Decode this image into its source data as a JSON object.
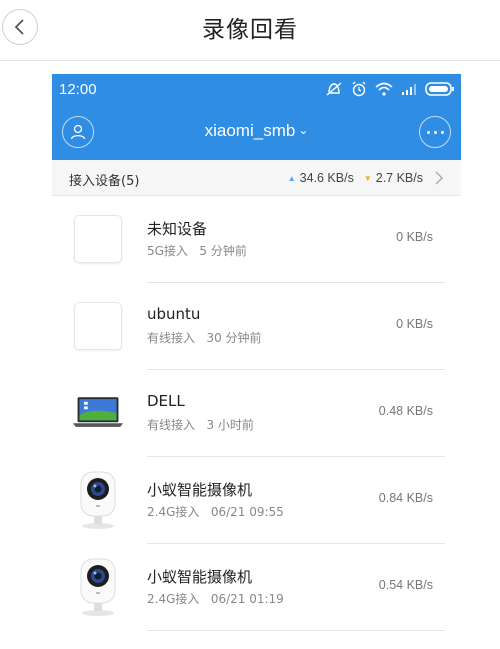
{
  "page": {
    "title": "录像回看"
  },
  "status_bar": {
    "time": "12:00"
  },
  "app_header": {
    "network_name": "xiaomi_smb"
  },
  "summary": {
    "label": "接入设备(5)",
    "upload_speed": "34.6 KB/s",
    "download_speed": "2.7 KB/s"
  },
  "devices": [
    {
      "name": "未知设备",
      "meta": "5G接入   5 分钟前",
      "speed": "0 KB/s",
      "icon": "blank-device-icon"
    },
    {
      "name": "ubuntu",
      "meta": "有线接入   30 分钟前",
      "speed": "0 KB/s",
      "icon": "blank-device-icon"
    },
    {
      "name": "DELL",
      "meta": "有线接入   3 小时前",
      "speed": "0.48 KB/s",
      "icon": "laptop-icon"
    },
    {
      "name": "小蚁智能摄像机",
      "meta": "2.4G接入   06/21 09:55",
      "speed": "0.84 KB/s",
      "icon": "camera-icon"
    },
    {
      "name": "小蚁智能摄像机",
      "meta": "2.4G接入   06/21 01:19",
      "speed": "0.54 KB/s",
      "icon": "camera-icon"
    }
  ],
  "colors": {
    "accent": "#2f8de4",
    "upload_arrow": "#4aa6ff",
    "download_arrow": "#f0b21e"
  }
}
